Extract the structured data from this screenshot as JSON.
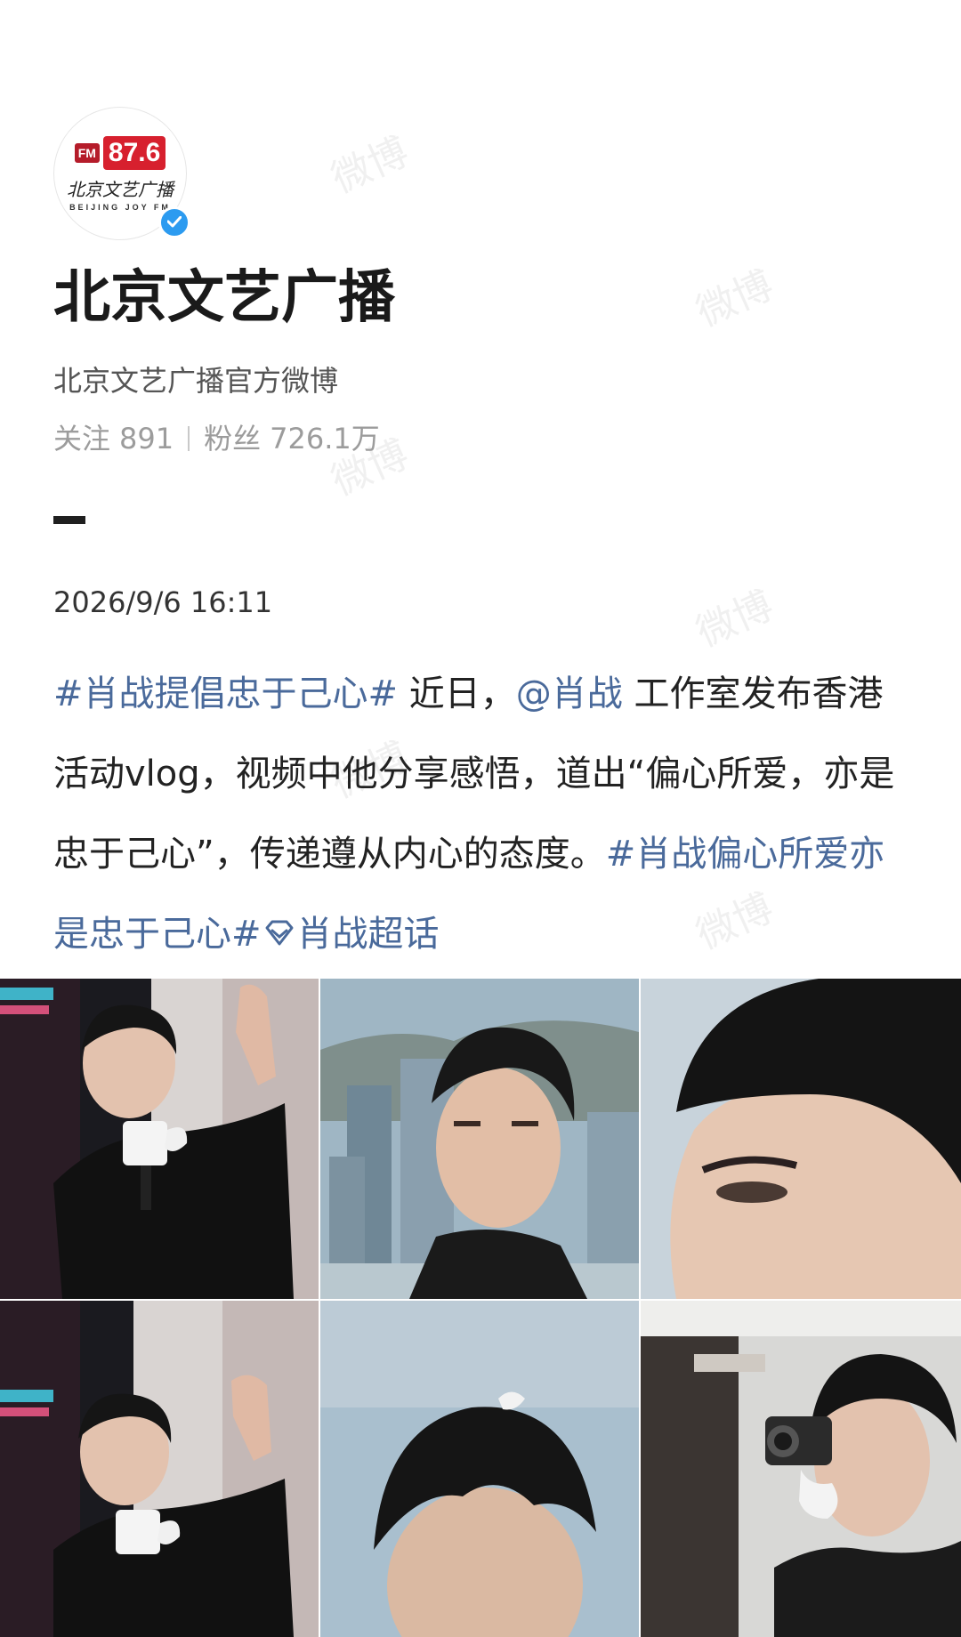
{
  "profile": {
    "avatar": {
      "fm_badge": "FM",
      "frequency": "87.6",
      "script_name": "北京文艺广播",
      "english_name": "BEIJING JOY FM",
      "verified_icon": "verified-check-icon",
      "verified_color": "#2c9bf0",
      "brand_color": "#d7202e"
    },
    "name": "北京文艺广播",
    "description": "北京文艺广播官方微博",
    "following_label": "关注",
    "following_count": "891",
    "followers_label": "粉丝",
    "followers_count": "726.1万"
  },
  "post": {
    "date": "2026/9/6 16:11",
    "text": {
      "hashtag_1": "#肖战提倡忠于己心#",
      "seg_1": " 近日，",
      "mention": "@肖战",
      "seg_2": " 工作室发布香港活动vlog，视频中他分享感悟，道出“偏心所爱，亦是忠于己心”，传递遵从内心的态度。",
      "hashtag_2": "#肖战偏心所爱亦是忠于己心#",
      "supertopic_icon": "diamond-icon",
      "supertopic": "肖战超话"
    },
    "link_color": "#4a6a9b",
    "images": [
      {
        "icon": "photo-waving-microphone"
      },
      {
        "icon": "photo-harbour-portrait"
      },
      {
        "icon": "photo-profile-closeup"
      },
      {
        "icon": "photo-waving-microphone-2"
      },
      {
        "icon": "photo-hair-closeup"
      },
      {
        "icon": "photo-camera"
      }
    ]
  },
  "watermark": "微博"
}
